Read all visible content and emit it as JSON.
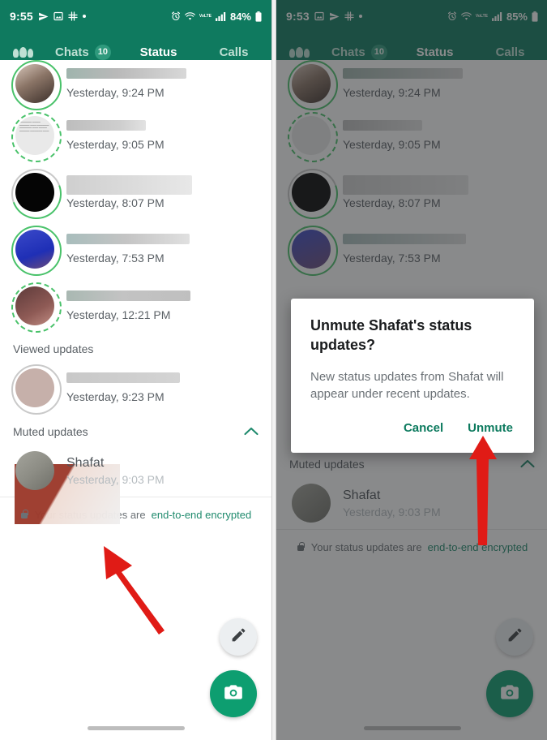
{
  "left_phone": {
    "statusbar": {
      "time": "9:55",
      "battery": "84%",
      "network_label": "VoLTE",
      "icons": [
        "send-icon",
        "photo-icon",
        "slack-icon",
        "dot-icon",
        "alarm-icon",
        "wifi-icon",
        "volte-icon",
        "signal-icon",
        "battery-icon"
      ]
    },
    "tabs": [
      {
        "name": "groups",
        "label": "",
        "badge": "",
        "active": false
      },
      {
        "name": "chats",
        "label": "Chats",
        "badge": "10",
        "active": false
      },
      {
        "name": "status",
        "label": "Status",
        "badge": "",
        "active": true
      },
      {
        "name": "calls",
        "label": "Calls",
        "badge": "",
        "active": false
      }
    ],
    "recent_updates": [
      {
        "name_redacted": true,
        "time": "Yesterday, 9:24 PM",
        "ring": "solid"
      },
      {
        "name_redacted": true,
        "time": "Yesterday, 9:05 PM",
        "ring": "dashed"
      },
      {
        "name_redacted": true,
        "time": "Yesterday, 8:07 PM",
        "ring": "half"
      },
      {
        "name_redacted": true,
        "time": "Yesterday, 7:53 PM",
        "ring": "solid"
      },
      {
        "name_redacted": true,
        "time": "Yesterday, 12:21 PM",
        "ring": "dashed"
      }
    ],
    "viewed_section": {
      "header": "Viewed updates",
      "items": [
        {
          "name_redacted": true,
          "time": "Yesterday, 9:23 PM"
        }
      ]
    },
    "muted_section": {
      "header": "Muted updates",
      "chevron": "chevron-up-icon",
      "items": [
        {
          "name": "Shafat",
          "time": "Yesterday, 9:03 PM"
        }
      ]
    },
    "encryption": {
      "prefix": "Your status updates are",
      "link": "end-to-end encrypted",
      "lock": "lock-icon"
    },
    "fabs": [
      {
        "name": "compose-text-status-fab",
        "icon": "pencil-icon"
      },
      {
        "name": "camera-status-fab",
        "icon": "camera-icon"
      }
    ]
  },
  "right_phone": {
    "statusbar": {
      "time": "9:53",
      "battery": "85%",
      "network_label": "VoLTE"
    },
    "tabs": [
      {
        "name": "groups",
        "label": "",
        "badge": "",
        "active": false
      },
      {
        "name": "chats",
        "label": "Chats",
        "badge": "10",
        "active": false
      },
      {
        "name": "status",
        "label": "Status",
        "badge": "",
        "active": true
      },
      {
        "name": "calls",
        "label": "Calls",
        "badge": "",
        "active": false
      }
    ],
    "recent_updates": [
      {
        "name_redacted": true,
        "time": "Yesterday, 9:24 PM",
        "ring": "solid"
      },
      {
        "name_redacted": true,
        "time": "Yesterday, 9:05 PM",
        "ring": "dashed"
      },
      {
        "name_redacted": true,
        "time": "Yesterday, 8:07 PM",
        "ring": "half"
      },
      {
        "name_redacted": true,
        "time": "Yesterday, 7:53 PM",
        "ring": "solid"
      }
    ],
    "muted_section": {
      "header": "Muted updates",
      "chevron": "chevron-up-icon",
      "items": [
        {
          "name": "Shafat",
          "time": "Yesterday, 9:03 PM"
        }
      ]
    },
    "encryption": {
      "prefix": "Your status updates are",
      "link": "end-to-end encrypted"
    },
    "dialog": {
      "title": "Unmute Shafat's status updates?",
      "body": "New status updates from Shafat will appear under recent updates.",
      "cancel_label": "Cancel",
      "confirm_label": "Unmute"
    }
  },
  "annotations": [
    {
      "name": "arrow-to-muted-shafat",
      "color": "#e01b16"
    },
    {
      "name": "arrow-to-unmute-button",
      "color": "#e01b16"
    }
  ],
  "colors": {
    "brand_green": "#0f7a5f",
    "accent_green": "#0c7a5e",
    "fab_green": "#0d9e70",
    "ring_green": "#49c26a",
    "arrow_red": "#e01b16",
    "scrim": "rgba(40,42,44,.55)"
  }
}
